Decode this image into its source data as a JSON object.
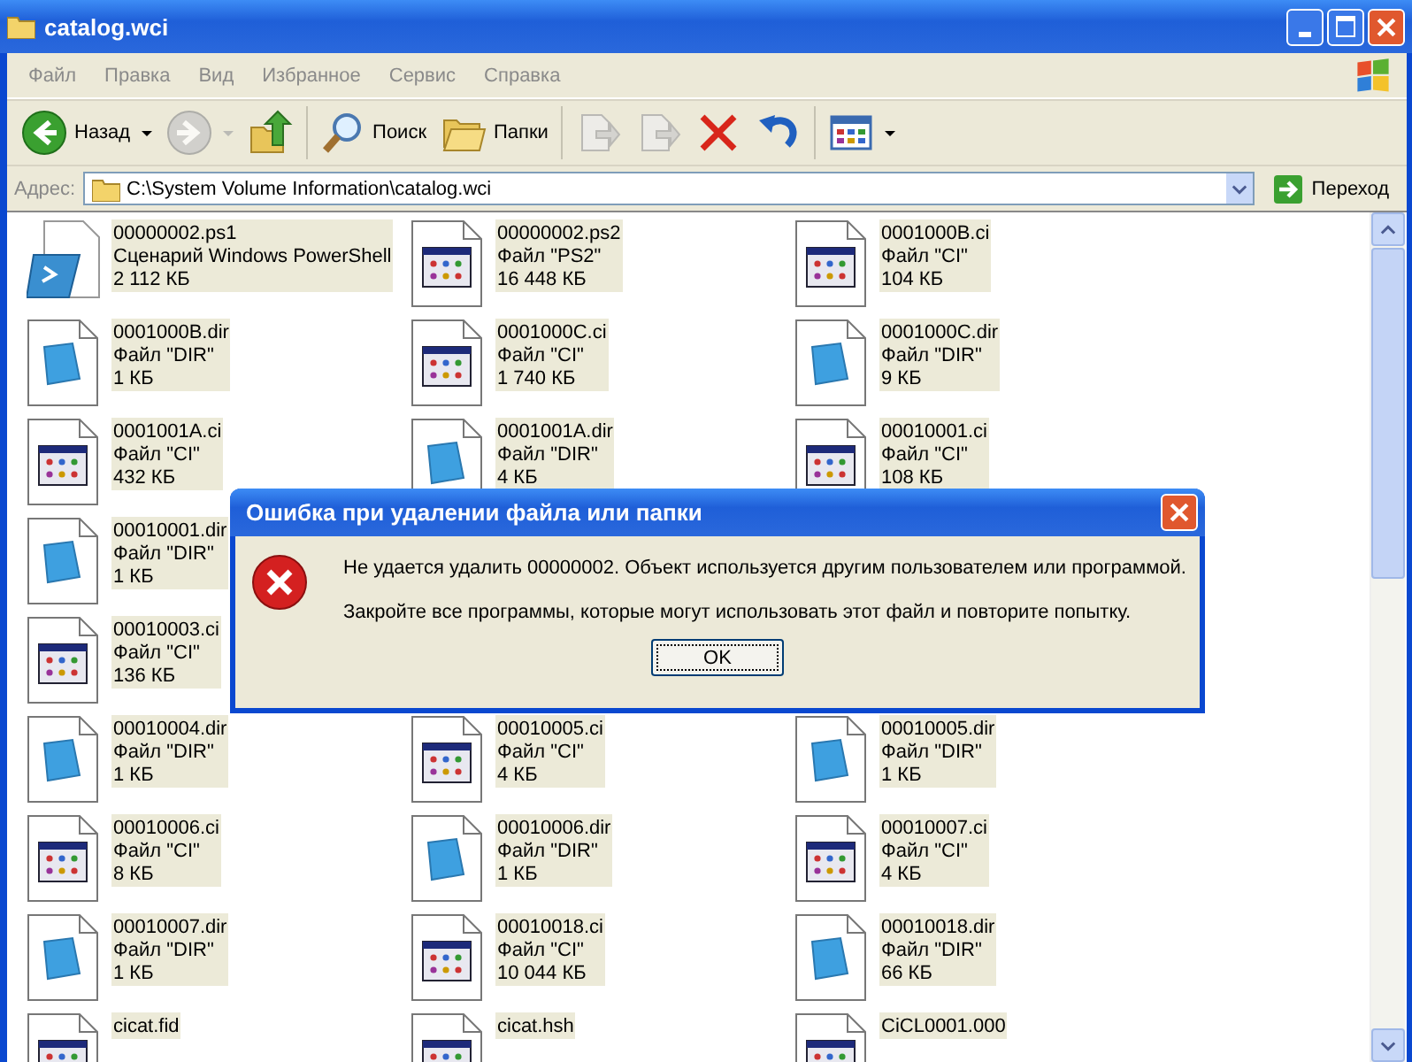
{
  "window": {
    "title": "catalog.wci"
  },
  "menu": [
    "Файл",
    "Правка",
    "Вид",
    "Избранное",
    "Сервис",
    "Справка"
  ],
  "toolbar": [
    {
      "kind": "back",
      "label": "Назад",
      "disabled": false
    },
    {
      "kind": "forward",
      "disabled": true
    },
    {
      "kind": "up",
      "disabled": false
    },
    {
      "kind": "separator"
    },
    {
      "kind": "search",
      "label": "Поиск",
      "disabled": false
    },
    {
      "kind": "folders",
      "label": "Папки",
      "disabled": false
    },
    {
      "kind": "separator"
    },
    {
      "kind": "move",
      "disabled": true
    },
    {
      "kind": "copy",
      "disabled": true
    },
    {
      "kind": "delete",
      "disabled": false
    },
    {
      "kind": "undo",
      "disabled": false
    },
    {
      "kind": "separator"
    },
    {
      "kind": "views",
      "disabled": false
    }
  ],
  "address": {
    "label": "Адрес:",
    "path": "C:\\System Volume Information\\catalog.wci",
    "go": "Переход"
  },
  "files": [
    [
      {
        "kind": "ps1",
        "name": "00000002.ps1",
        "type": "Сценарий Windows PowerShell",
        "size": "2 112 КБ"
      },
      {
        "kind": "ci",
        "name": "00000002.ps2",
        "type": "Файл \"PS2\"",
        "size": "16 448 КБ"
      },
      {
        "kind": "ci",
        "name": "0001000B.ci",
        "type": "Файл \"CI\"",
        "size": "104 КБ"
      }
    ],
    [
      {
        "kind": "dir",
        "name": "0001000B.dir",
        "type": "Файл \"DIR\"",
        "size": "1 КБ"
      },
      {
        "kind": "ci",
        "name": "0001000C.ci",
        "type": "Файл \"CI\"",
        "size": "1 740 КБ"
      },
      {
        "kind": "dir",
        "name": "0001000C.dir",
        "type": "Файл \"DIR\"",
        "size": "9 КБ"
      }
    ],
    [
      {
        "kind": "ci",
        "name": "0001001A.ci",
        "type": "Файл \"CI\"",
        "size": "432 КБ"
      },
      {
        "kind": "dir",
        "name": "0001001A.dir",
        "type": "Файл \"DIR\"",
        "size": "4 КБ"
      },
      {
        "kind": "ci",
        "name": "00010001.ci",
        "type": "Файл \"CI\"",
        "size": "108 КБ"
      }
    ],
    [
      {
        "kind": "dir",
        "name": "00010001.dir",
        "type": "Файл \"DIR\"",
        "size": "1 КБ"
      }
    ],
    [
      {
        "kind": "ci",
        "name": "00010003.ci",
        "type": "Файл \"CI\"",
        "size": "136 КБ"
      }
    ],
    [
      {
        "kind": "dir",
        "name": "00010004.dir",
        "type": "Файл \"DIR\"",
        "size": "1 КБ"
      },
      {
        "kind": "ci",
        "name": "00010005.ci",
        "type": "Файл \"CI\"",
        "size": "4 КБ"
      },
      {
        "kind": "dir",
        "name": "00010005.dir",
        "type": "Файл \"DIR\"",
        "size": "1 КБ"
      }
    ],
    [
      {
        "kind": "ci",
        "name": "00010006.ci",
        "type": "Файл \"CI\"",
        "size": "8 КБ"
      },
      {
        "kind": "dir",
        "name": "00010006.dir",
        "type": "Файл \"DIR\"",
        "size": "1 КБ"
      },
      {
        "kind": "ci",
        "name": "00010007.ci",
        "type": "Файл \"CI\"",
        "size": "4 КБ"
      }
    ],
    [
      {
        "kind": "dir",
        "name": "00010007.dir",
        "type": "Файл \"DIR\"",
        "size": "1 КБ"
      },
      {
        "kind": "ci",
        "name": "00010018.ci",
        "type": "Файл \"CI\"",
        "size": "10 044 КБ"
      },
      {
        "kind": "dir",
        "name": "00010018.dir",
        "type": "Файл \"DIR\"",
        "size": "66 КБ"
      }
    ],
    [
      {
        "kind": "ci",
        "name": "cicat.fid"
      },
      {
        "kind": "ci",
        "name": "cicat.hsh"
      },
      {
        "kind": "ci",
        "name": "CiCL0001.000"
      }
    ]
  ],
  "dialog": {
    "title": "Ошибка при удалении файла или папки",
    "message": "Не удается удалить 00000002. Объект используется другим пользователем или программой.",
    "hint": "Закройте все программы, которые могут использовать этот файл и повторите попытку.",
    "ok": "OK"
  }
}
